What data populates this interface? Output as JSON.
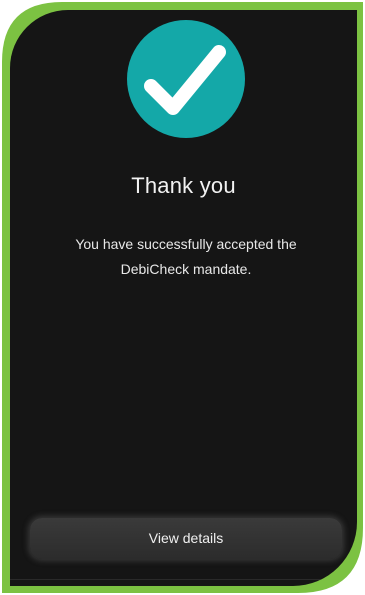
{
  "colors": {
    "frame_green": "#7cc242",
    "screen_bg": "#151515",
    "check_teal": "#14a8a8",
    "button_bg": "#333333"
  },
  "success": {
    "icon": "checkmark-icon",
    "title": "Thank you",
    "message": "You have successfully accepted the DebiCheck mandate."
  },
  "actions": {
    "view_details_label": "View details"
  }
}
